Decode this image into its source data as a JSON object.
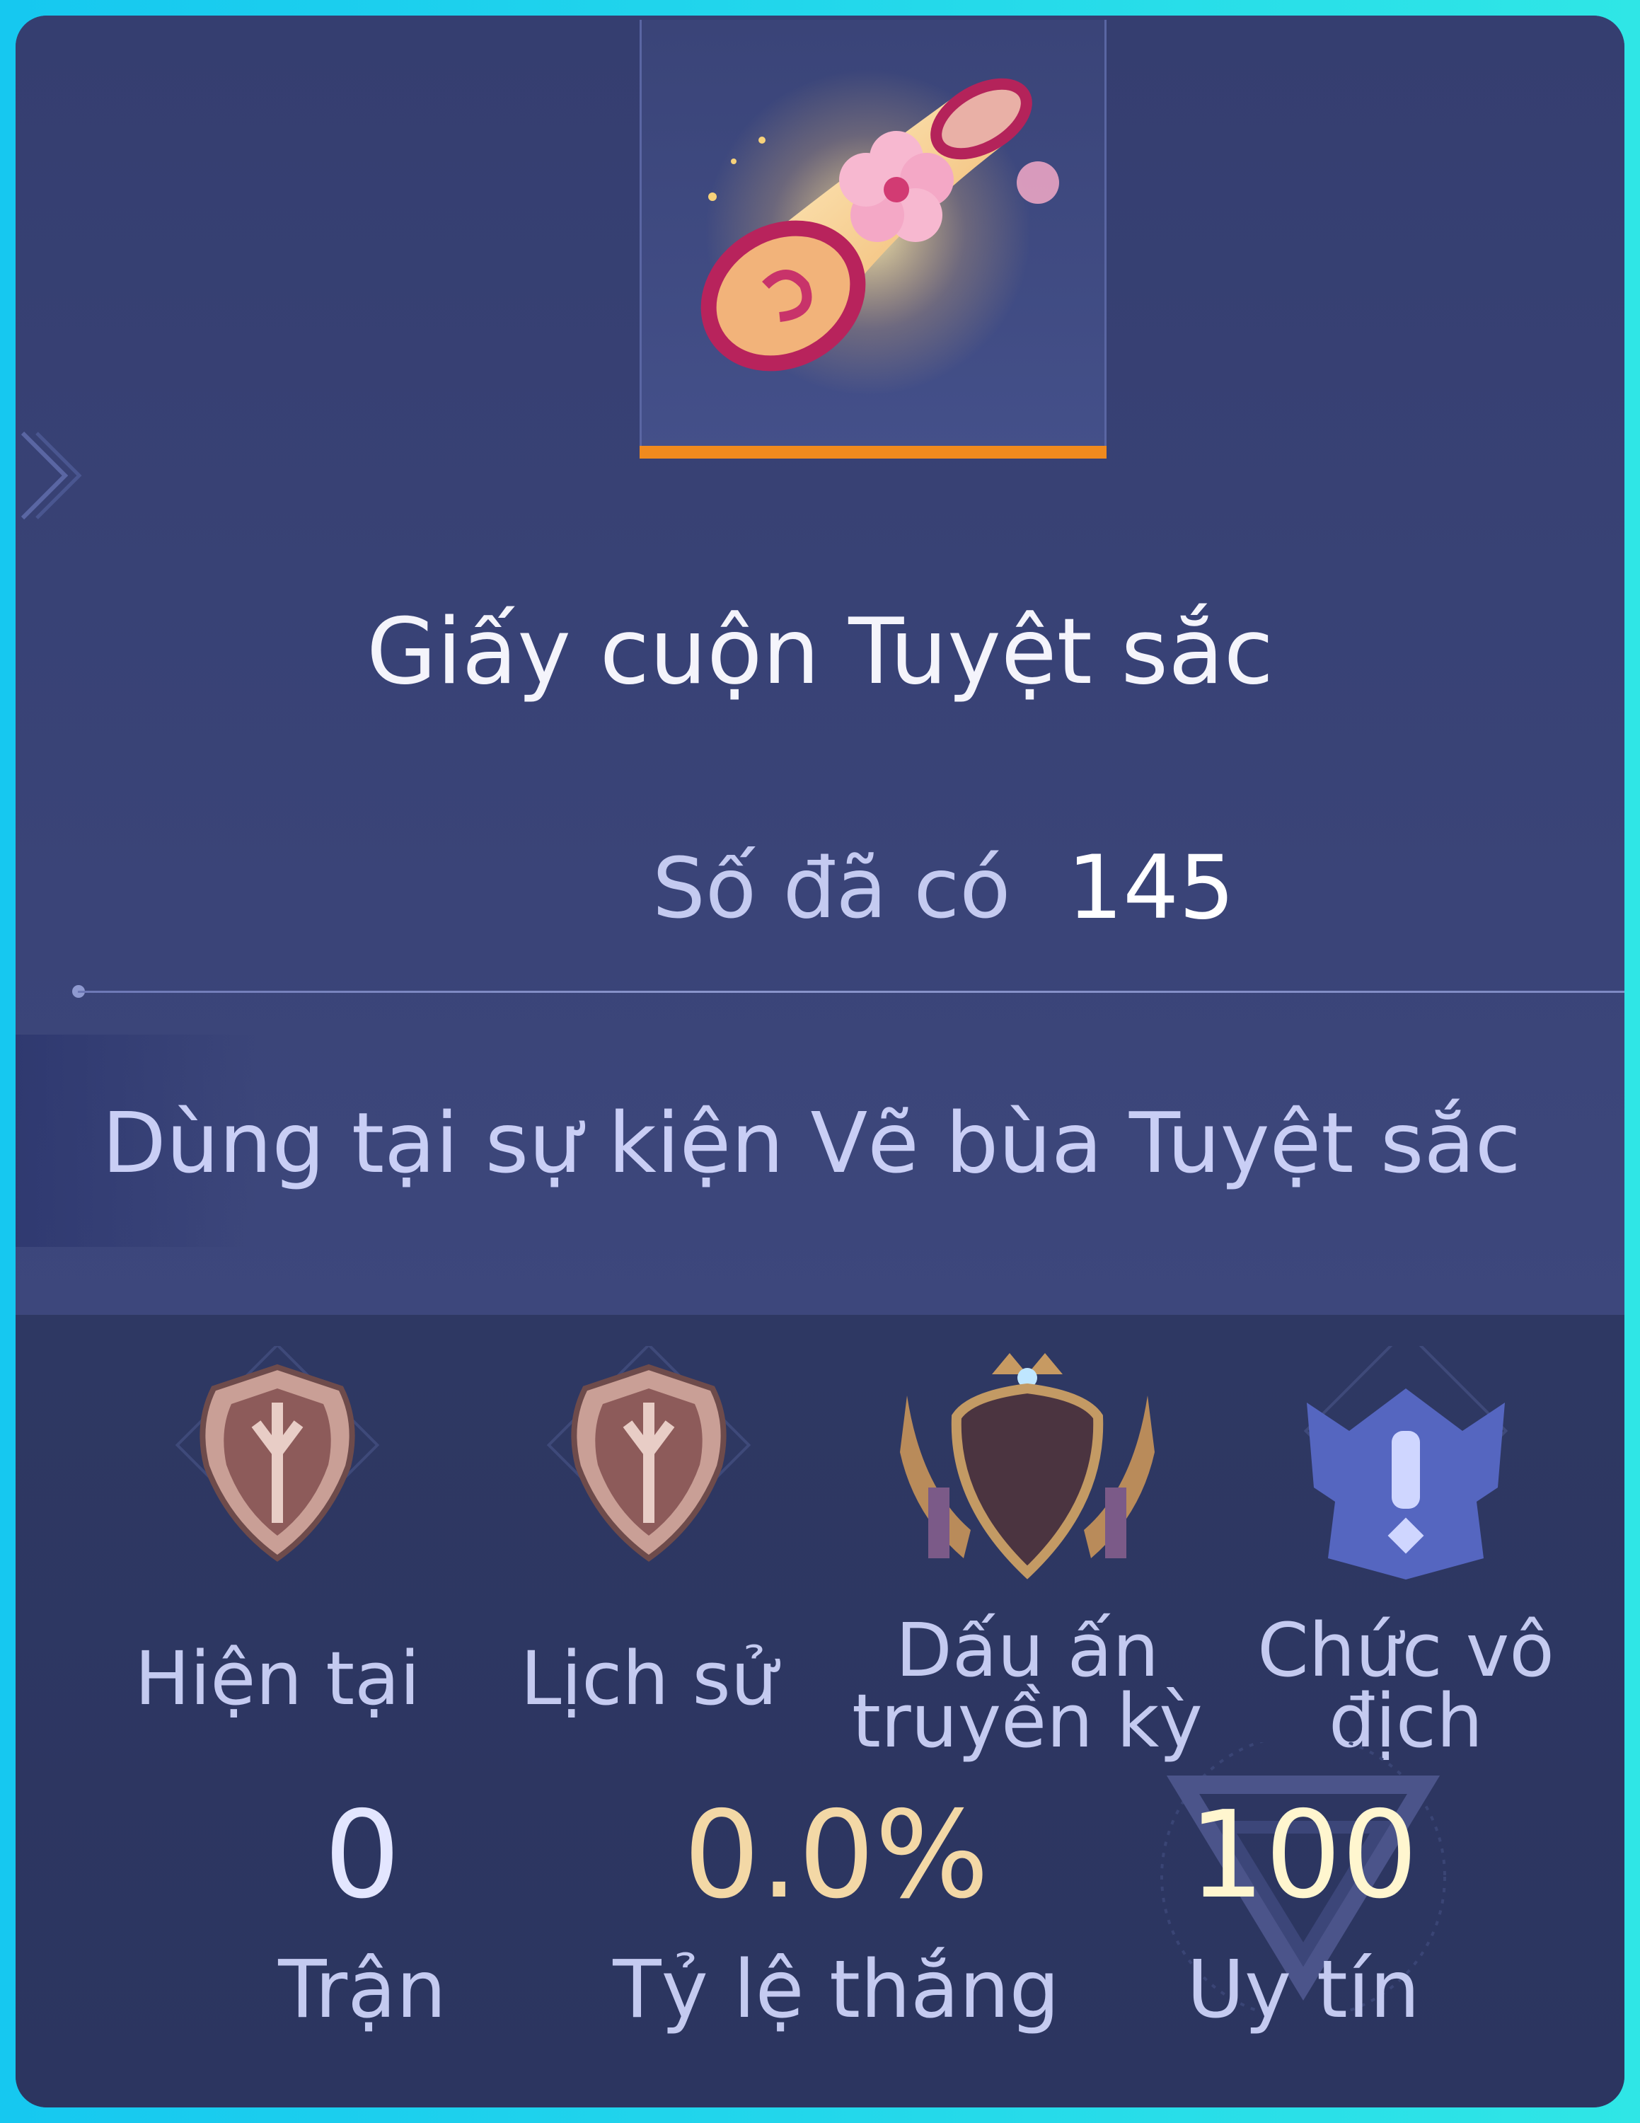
{
  "item": {
    "name": "Giấy cuộn Tuyệt sắc",
    "icon": "scroll-with-flower-icon",
    "rarity_color": "#f08a1e",
    "owned_label": "Số đã có",
    "owned_count": "145",
    "usage": "Dùng tại sự kiện Vẽ bùa Tuyệt sắc"
  },
  "badges": [
    {
      "label": "Hiện tại",
      "icon": "bronze-shield-rank-icon"
    },
    {
      "label": "Lịch sử",
      "icon": "bronze-shield-rank-icon"
    },
    {
      "label_line1": "Dấu ấn",
      "label_line2": "truyền kỳ",
      "icon": "crowned-winged-crest-icon"
    },
    {
      "label_line1": "Chức vô",
      "label_line2": "địch",
      "icon": "champion-locked-exclamation-icon"
    }
  ],
  "stats": [
    {
      "value": "0",
      "label": "Trận",
      "color": "#e3e6ff"
    },
    {
      "value": "0.0%",
      "label": "Tỷ lệ thắng",
      "color": "#f3d8a6"
    },
    {
      "value": "100",
      "label": "Uy tín",
      "color": "#fff6cf"
    }
  ],
  "colors": {
    "frame": "#1fd4ee",
    "card": "#3a4477",
    "lower_panel": "#2e3863"
  }
}
